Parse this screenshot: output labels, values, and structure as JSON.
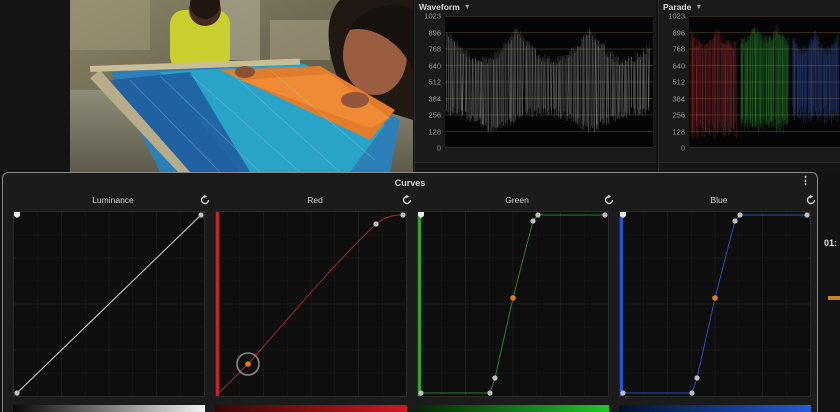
{
  "scopes": {
    "waveform": {
      "title": "Waveform"
    },
    "parade": {
      "title": "Parade"
    },
    "scale": [
      "1023",
      "896",
      "768",
      "640",
      "512",
      "384",
      "256",
      "128",
      "0"
    ]
  },
  "curves": {
    "title": "Curves",
    "channels": [
      {
        "name": "Luminance",
        "color": "#cfcfcf"
      },
      {
        "name": "Red",
        "color": "#d0303a"
      },
      {
        "name": "Green",
        "color": "#3bbd3b"
      },
      {
        "name": "Blue",
        "color": "#3a6ee0"
      }
    ]
  },
  "timecode": "01:"
}
